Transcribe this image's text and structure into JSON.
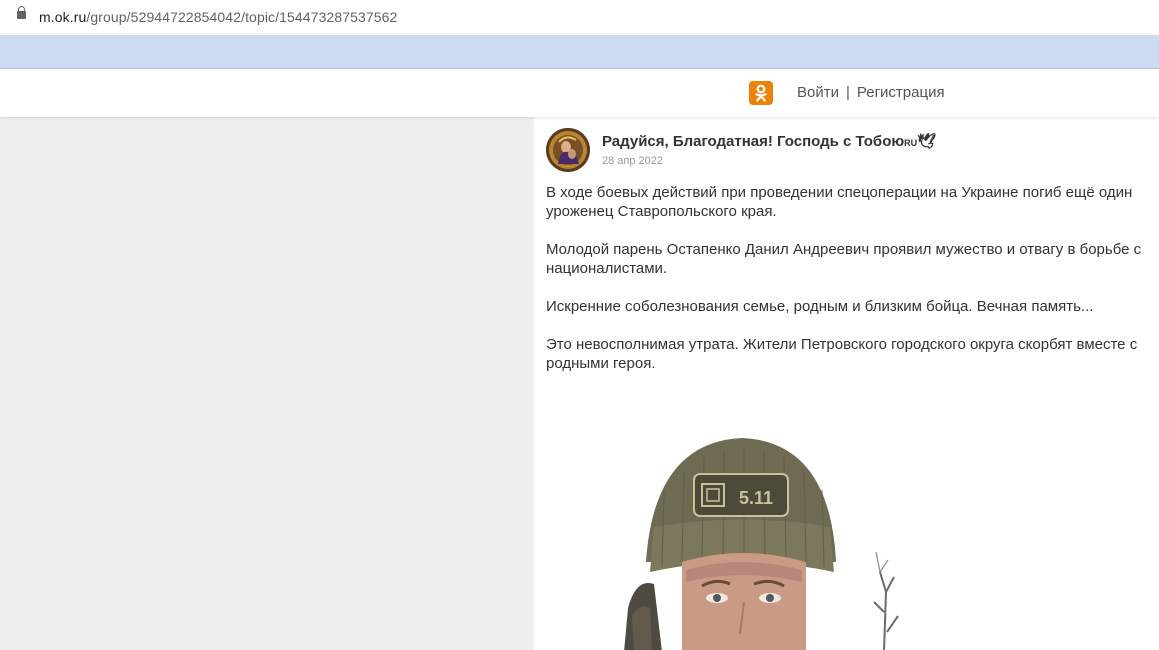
{
  "browser": {
    "url_host": "m.ok.ru",
    "url_path": "/group/52944722854042/topic/154473287537562"
  },
  "header": {
    "logo_icon": "odnoklassniki-icon",
    "accent_color": "#ee8208",
    "login_label": "Войти",
    "separator": "|",
    "register_label": "Регистрация"
  },
  "group": {
    "title": "Радуйся, Благодатная! Господь с Тобою",
    "title_suffix": "RU",
    "title_emoji": "🕊",
    "date": "28 апр 2022"
  },
  "post": {
    "paragraphs": [
      "В ходе боевых действий при проведении спецоперации на Украине погиб ещё один уроженец Ставропольского края.",
      "Молодой парень Остапенко Данил Андреевич проявил мужество и отвагу в борьбе с националистами.",
      "Искренние соболезнования семье, родным и близким бойца. Вечная память...",
      "Это невосполнимая утрата. Жители Петровского городского округа скорбят вместе с родными героя."
    ],
    "photo_patch_text": "5.11"
  }
}
